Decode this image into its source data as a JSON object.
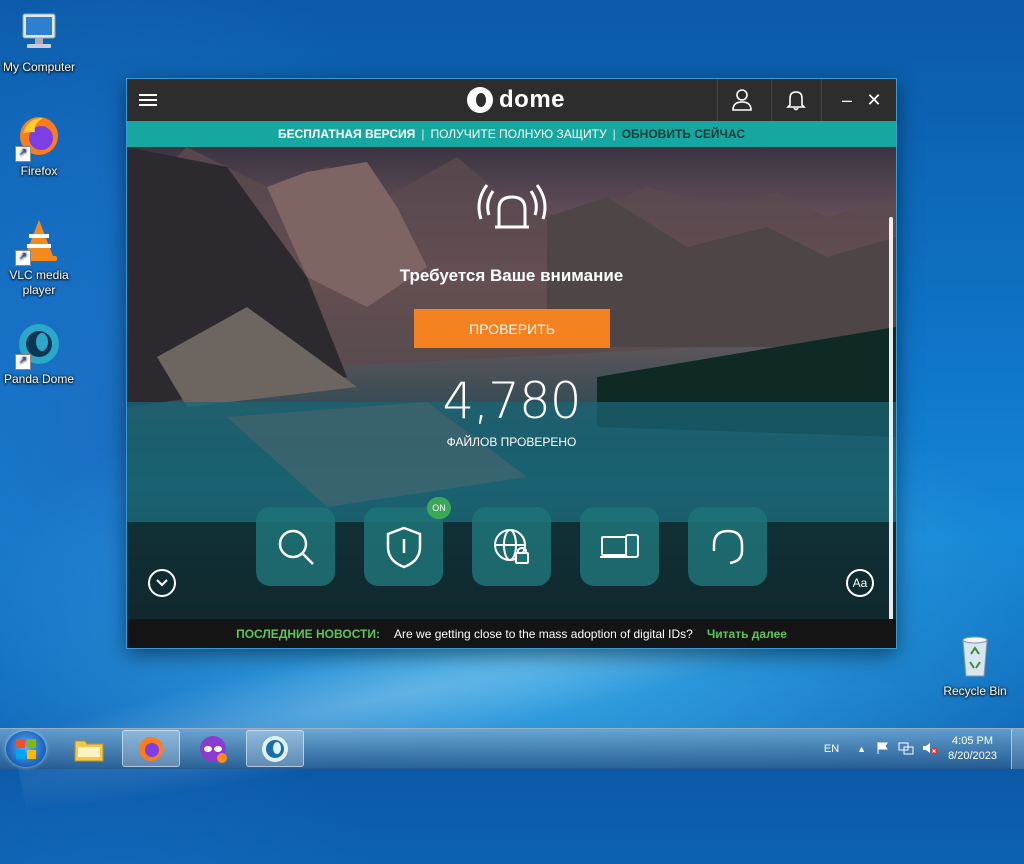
{
  "desktop": {
    "icons": [
      {
        "label": "My Computer"
      },
      {
        "label": "Firefox"
      },
      {
        "label": "VLC media player"
      },
      {
        "label": "Panda Dome"
      },
      {
        "label": "Recycle Bin"
      }
    ]
  },
  "app": {
    "brand": "dome",
    "promo": {
      "free": "БЕСПЛАТНАЯ ВЕРСИЯ",
      "sep": "|",
      "get": "ПОЛУЧИТЕ ПОЛНУЮ ЗАЩИТУ",
      "upgrade": "ОБНОВИТЬ СЕЙЧАС"
    },
    "alert_title": "Требуется Ваше внимание",
    "check_button": "ПРОВЕРИТЬ",
    "files_count": "4,780",
    "files_label": "ФАЙЛОВ ПРОВЕРЕНО",
    "tiles": [
      {
        "icon": "search-icon"
      },
      {
        "icon": "shield-icon",
        "badge": "ON"
      },
      {
        "icon": "web-lock-icon"
      },
      {
        "icon": "devices-icon"
      },
      {
        "icon": "headset-icon"
      }
    ],
    "font_button": "Aa",
    "news": {
      "label": "ПОСЛЕДНИЕ НОВОСТИ:",
      "text": "Are we getting close to the mass adoption of digital IDs?",
      "more": "Читать далее"
    }
  },
  "taskbar": {
    "lang": "EN",
    "time": "4:05 PM",
    "date": "8/20/2023"
  },
  "colors": {
    "promo_bar": "#16a8a0",
    "check_button": "#f58220",
    "news_accent": "#5fc55b",
    "tile": "#1f7378"
  }
}
